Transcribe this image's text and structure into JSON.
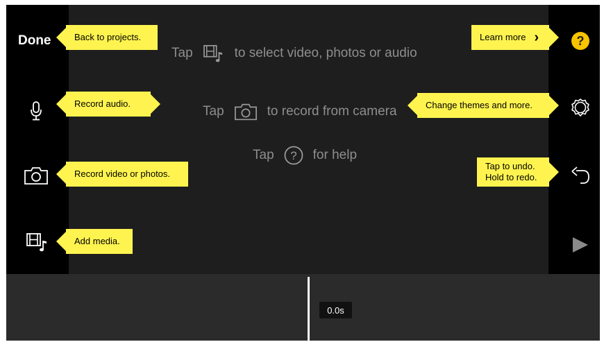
{
  "sidebar_left": {
    "done_label": "Done"
  },
  "callouts": {
    "back": "Back to projects.",
    "record_audio": "Record audio.",
    "record_video": "Record video or photos.",
    "add_media": "Add media.",
    "learn_more": "Learn more",
    "change_themes": "Change themes and more.",
    "undo_line1": "Tap to undo.",
    "undo_line2": "Hold to redo."
  },
  "hints": {
    "tap": "Tap",
    "select_media": "to select video, photos or audio",
    "record_camera": "to record from camera",
    "help": "for help"
  },
  "timeline": {
    "time": "0.0s"
  },
  "icons": {
    "media": "film-music-icon",
    "mic": "microphone-icon",
    "camera": "camera-icon",
    "help": "question-icon",
    "settings": "gear-icon",
    "undo": "undo-icon",
    "play": "play-icon"
  },
  "colors": {
    "callout": "#fff44f",
    "help_button": "#f8c400",
    "background": "#1e1e1e",
    "rail": "#000000"
  }
}
